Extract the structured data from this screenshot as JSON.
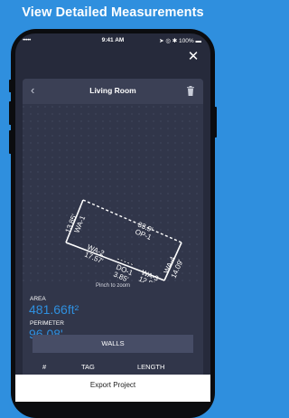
{
  "headline": "View Detailed Measurements",
  "status_bar": {
    "time": "9:41 AM",
    "signal": "•••••",
    "right": "➤ ◎ ✱ 100% ▬"
  },
  "room": {
    "title": "Living Room",
    "plan_labels": {
      "wa1_len": "13.85'",
      "wa1": "WA-1",
      "op1_len": "33.9'",
      "op1": "OP-1",
      "wa2": "WA-2",
      "wa2_len": "17.57'",
      "do1": "DO-1",
      "do1_len": "3.85'",
      "wa3": "WA-3",
      "wa3_len": "12.82'",
      "wa4": "WA-4",
      "wa4_len": "14.09'"
    },
    "hint": "Pinch to zoom",
    "area_label": "AREA",
    "area_value": "481.66ft²",
    "perimeter_label": "PERIMETER",
    "perimeter_value": "96.08'",
    "walls_button": "WALLS",
    "columns": [
      "#",
      "TAG",
      "LENGTH"
    ]
  },
  "export_button": "Export Project",
  "colors": {
    "accent": "#2f8fde",
    "panel": "#31364a",
    "screen": "#262a3b"
  }
}
